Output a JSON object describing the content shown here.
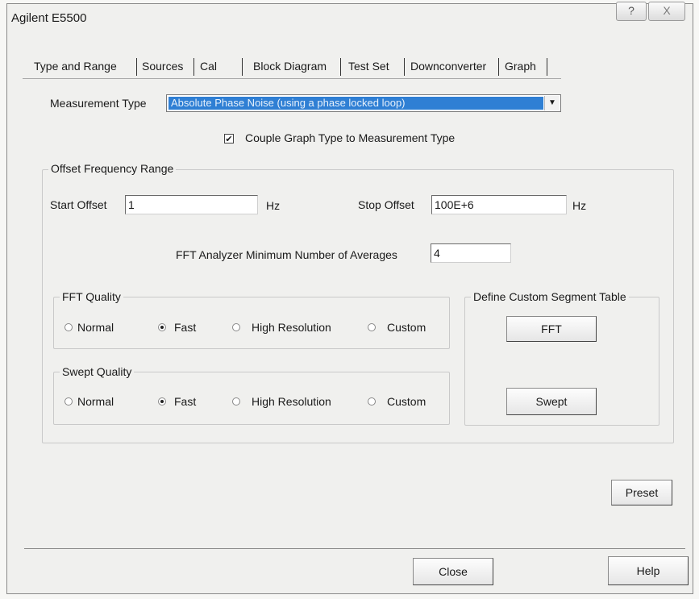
{
  "window": {
    "title": "Agilent E5500",
    "help_glyph": "?",
    "close_glyph": "X"
  },
  "tabs": [
    {
      "label": "Type and Range"
    },
    {
      "label": "Sources"
    },
    {
      "label": "Cal"
    },
    {
      "label": "Block Diagram"
    },
    {
      "label": "Test Set"
    },
    {
      "label": "Downconverter"
    },
    {
      "label": "Graph"
    }
  ],
  "measurement": {
    "label": "Measurement Type",
    "value": "Absolute Phase Noise (using a phase locked loop)",
    "couple_label": "Couple Graph Type to Measurement Type",
    "couple_checked": true
  },
  "offset": {
    "title": "Offset Frequency Range",
    "start_label": "Start Offset",
    "start_value": "1",
    "start_unit": "Hz",
    "stop_label": "Stop Offset",
    "stop_value": "100E+6",
    "stop_unit": "Hz",
    "averages_label": "FFT Analyzer Minimum Number of Averages",
    "averages_value": "4"
  },
  "fft_quality": {
    "title": "FFT Quality",
    "options": [
      "Normal",
      "Fast",
      "High Resolution",
      "Custom"
    ],
    "selected": "Fast"
  },
  "swept_quality": {
    "title": "Swept Quality",
    "options": [
      "Normal",
      "Fast",
      "High Resolution",
      "Custom"
    ],
    "selected": "Fast"
  },
  "segment_table": {
    "title": "Define Custom Segment Table",
    "fft_button": "FFT",
    "swept_button": "Swept"
  },
  "buttons": {
    "preset": "Preset",
    "close": "Close",
    "help": "Help"
  }
}
